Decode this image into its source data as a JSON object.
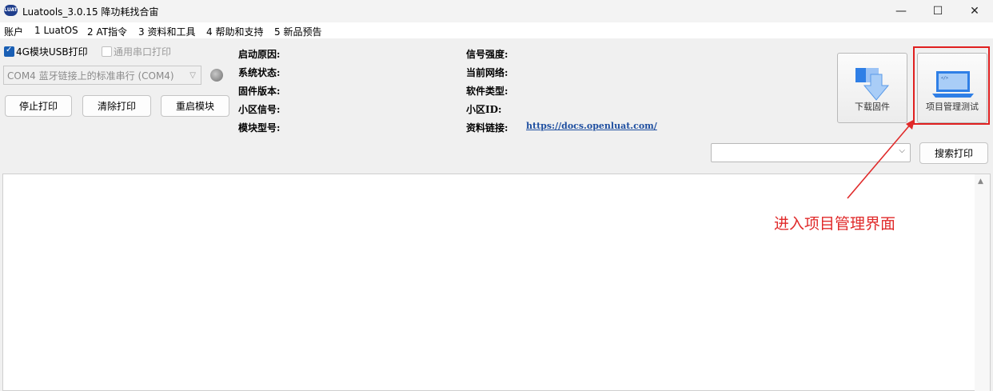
{
  "window": {
    "title": "Luatools_3.0.15 降功耗找合宙",
    "logo_text": "LUAT",
    "controls": {
      "minimize": "—",
      "maximize": "☐",
      "close": "✕"
    }
  },
  "menu": [
    "账户",
    "1 LuatOS",
    "2 AT指令",
    "3 资料和工具",
    "4 帮助和支持",
    "5 新品预告"
  ],
  "options": {
    "usb_print": {
      "label": "4G模块USB打印",
      "checked": true
    },
    "serial_print": {
      "label": "通用串口打印",
      "checked": false
    }
  },
  "com_port": {
    "value": "COM4 蓝牙链接上的标准串行 (COM4)"
  },
  "buttons": {
    "stop": "停止打印",
    "clear": "清除打印",
    "restart": "重启模块",
    "search": "搜索打印"
  },
  "info": {
    "left": [
      "启动原因:",
      "系统状态:",
      "固件版本:",
      "小区信号:",
      "模块型号:"
    ],
    "right": [
      "信号强度:",
      "当前网络:",
      "软件类型:",
      "小区ID:",
      "资料链接:"
    ],
    "link": "https://docs.openluat.com/"
  },
  "big_buttons": {
    "download": "下载固件",
    "project": "项目管理测试"
  },
  "annotation": {
    "text": "进入项目管理界面",
    "color": "#e02a2a"
  },
  "colors": {
    "accent": "#1a5fb4",
    "highlight": "#e02020",
    "icon_blue": "#2f7fe6"
  }
}
